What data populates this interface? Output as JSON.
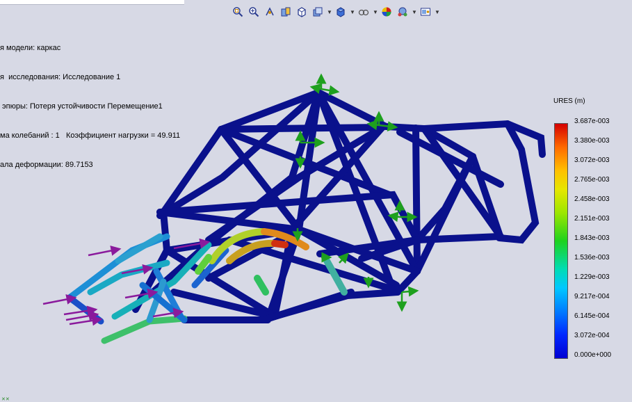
{
  "info_lines": [
    "я модели: каркас",
    "я  исследования: Исследование 1",
    " эпюры: Потеря устойчивости Перемещение1",
    "ма колебаний : 1   Коэффициент нагрузки = 49.911",
    "ала деформации: 89.7153"
  ],
  "toolbar": {
    "buttons": [
      {
        "name": "zoom-to-fit-icon",
        "caret": false
      },
      {
        "name": "zoom-to-area-icon",
        "caret": false
      },
      {
        "name": "previous-view-icon",
        "caret": false
      },
      {
        "name": "section-view-icon",
        "caret": false
      },
      {
        "name": "view-orientation-icon",
        "caret": false
      },
      {
        "name": "display-style-icon",
        "caret": true
      },
      {
        "name": "hide-show-items-icon",
        "caret": true
      },
      {
        "name": "edit-appearance-icon",
        "caret": true
      },
      {
        "name": "apply-scene-icon",
        "caret": false
      },
      {
        "name": "render-tools-icon",
        "caret": true
      },
      {
        "name": "view-settings-icon",
        "caret": true
      }
    ]
  },
  "legend": {
    "title": "URES (m)",
    "ticks": [
      "3.687e-003",
      "3.380e-003",
      "3.072e-003",
      "2.765e-003",
      "2.458e-003",
      "2.151e-003",
      "1.843e-003",
      "1.536e-003",
      "1.229e-003",
      "9.217e-004",
      "6.145e-004",
      "3.072e-004",
      "0.000e+000"
    ]
  },
  "colors": {
    "background": "#d7d9e5",
    "frame": "#0a118c",
    "load_arrow": "#8a1a9c",
    "fixture_arrow": "#1ea01e"
  },
  "corner_mark": "✕✕"
}
